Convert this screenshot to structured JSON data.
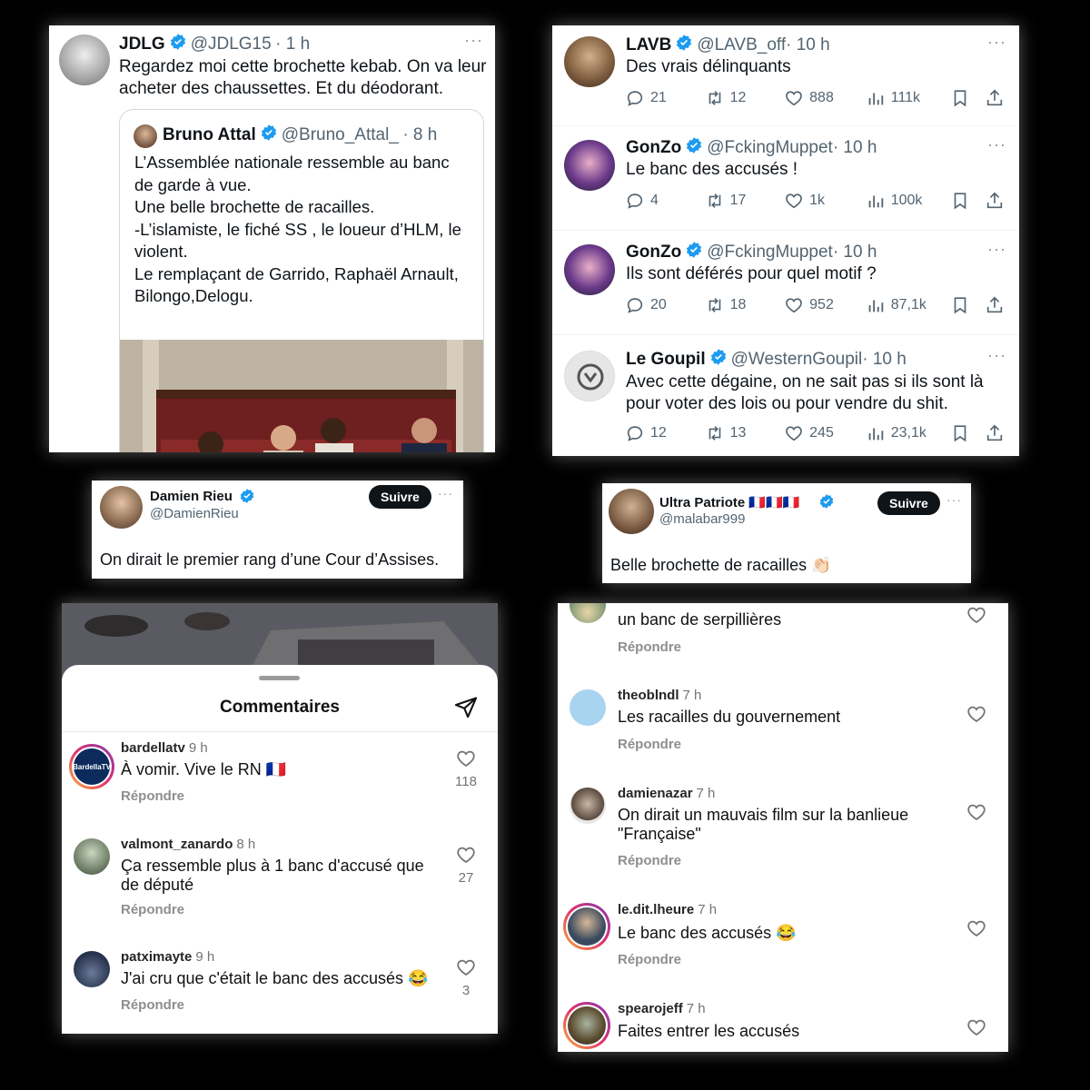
{
  "colors": {
    "verified": "#1d9bf0",
    "background": "#000000"
  },
  "panel1": {
    "name": "JDLG",
    "handle": "@JDLG15",
    "time": "· 1 h",
    "text": "Regardez moi cette brochette kebab. On va leur acheter des chaussettes. Et du déodorant.",
    "quote": {
      "name": "Bruno Attal",
      "handle": "@Bruno_Attal_",
      "time": "· 8 h",
      "lines": [
        "L’Assemblée nationale ressemble au banc",
        "de garde à vue.",
        "Une belle brochette de racailles.",
        "-L’islamiste, le fiché SS , le loueur d’HLM, le",
        "violent.",
        "Le remplaçant de Garrido, Raphaël Arnault,",
        "Bilongo,Delogu."
      ]
    }
  },
  "panel2": {
    "tweets": [
      {
        "name": "LAVB",
        "handle": "@LAVB_off",
        "time": "· 10 h",
        "text": "Des vrais délinquants",
        "replies": "21",
        "retweets": "12",
        "likes": "888",
        "views": "111k"
      },
      {
        "name": "GonZo",
        "handle": "@FckingMuppet",
        "time": "· 10 h",
        "text": "Le banc des accusés !",
        "replies": "4",
        "retweets": "17",
        "likes": "1k",
        "views": "100k"
      },
      {
        "name": "GonZo",
        "handle": "@FckingMuppet",
        "time": "· 10 h",
        "text": "Ils sont déférés pour quel motif ?",
        "replies": "20",
        "retweets": "18",
        "likes": "952",
        "views": "87,1k"
      },
      {
        "name": "Le Goupil",
        "handle": "@WesternGoupil",
        "time": "· 10 h",
        "text": "Avec cette dégaine, on ne sait pas si ils sont là pour voter des lois ou pour vendre du shit.",
        "replies": "12",
        "retweets": "13",
        "likes": "245",
        "views": "23,1k"
      }
    ]
  },
  "panel3": {
    "name": "Damien Rieu",
    "handle": "@DamienRieu",
    "follow": "Suivre",
    "text": "On dirait le premier rang d’une Cour d’Assises."
  },
  "panel4": {
    "name": "Ultra Patriote 🇫🇷🇫🇷🇫🇷",
    "handle": "@malabar999",
    "follow": "Suivre",
    "text": "Belle brochette de racailles 👏🏻"
  },
  "panel5": {
    "title": "Commentaires",
    "comments": [
      {
        "user": "bardellatv",
        "time": "9 h",
        "text": "À vomir. Vive le RN 🇫🇷",
        "reply": "Répondre",
        "likes": "118",
        "avatar_label": "BardellaTV"
      },
      {
        "user": "valmont_zanardo",
        "time": "8 h",
        "text_line1": "Ça ressemble plus à 1 banc d'accusé que",
        "text_line2": "de député",
        "reply": "Répondre",
        "likes": "27"
      },
      {
        "user": "patximayte",
        "time": "9 h",
        "text": "J'ai cru que c'était le banc des accusés 😂",
        "reply": "Répondre",
        "likes": "3"
      }
    ]
  },
  "panel6": {
    "comments": [
      {
        "text": "un banc de serpillières",
        "reply": "Répondre"
      },
      {
        "user": "theoblndl",
        "time": "7 h",
        "text": "Les racailles du gouvernement",
        "reply": "Répondre"
      },
      {
        "user": "damienazar",
        "time": "7 h",
        "text_line1": "On dirait un mauvais film sur la banlieue",
        "text_line2": "\"Française\"",
        "reply": "Répondre"
      },
      {
        "user": "le.dit.lheure",
        "time": "7 h",
        "text": "Le banc des accusés 😂",
        "reply": "Répondre"
      },
      {
        "user": "spearojeff",
        "time": "7 h",
        "text": "Faites entrer les accusés"
      }
    ]
  }
}
